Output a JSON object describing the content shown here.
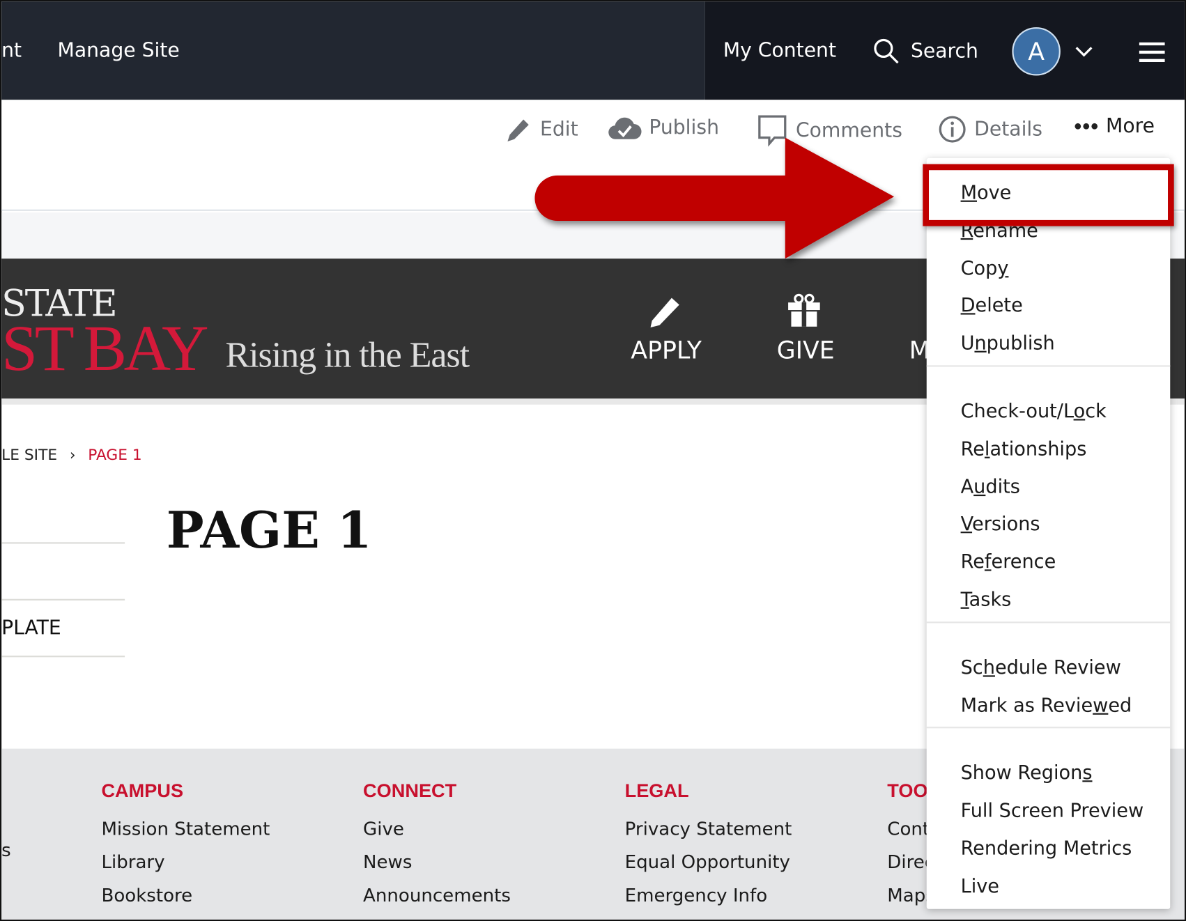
{
  "topnav": {
    "partial_left": "nt",
    "manage_site": "Manage Site",
    "my_content": "My Content",
    "search": "Search",
    "avatar_initial": "A"
  },
  "toolbar": {
    "edit": "Edit",
    "publish": "Publish",
    "comments": "Comments",
    "details": "Details",
    "more": "More"
  },
  "banner": {
    "logo_line1": "STATE",
    "logo_line2": "ST BAY",
    "tagline": "Rising in the East",
    "nav": [
      "APPLY",
      "GIVE",
      "M"
    ]
  },
  "breadcrumb": {
    "parent": "LE SITE",
    "separator": "›",
    "current": "PAGE 1"
  },
  "page": {
    "title": "PAGE 1",
    "sidebar_partial": "PLATE"
  },
  "footer": {
    "partial_left": "s",
    "columns": [
      {
        "heading": "CAMPUS",
        "links": [
          "Mission Statement",
          "Library",
          "Bookstore"
        ]
      },
      {
        "heading": "CONNECT",
        "links": [
          "Give",
          "News",
          "Announcements"
        ]
      },
      {
        "heading": "LEGAL",
        "links": [
          "Privacy Statement",
          "Equal Opportunity",
          "Emergency Info"
        ]
      },
      {
        "heading": "TOO",
        "links": [
          "Cont",
          "Direc",
          "Maps"
        ]
      }
    ]
  },
  "more_menu": {
    "groups": [
      [
        {
          "pre": "",
          "key": "M",
          "post": "ove"
        },
        {
          "pre": "",
          "key": "R",
          "post": "ename"
        },
        {
          "pre": "Cop",
          "key": "y",
          "post": ""
        },
        {
          "pre": "",
          "key": "D",
          "post": "elete"
        },
        {
          "pre": "U",
          "key": "n",
          "post": "publish"
        }
      ],
      [
        {
          "pre": "Check-out/L",
          "key": "o",
          "post": "ck"
        },
        {
          "pre": "Re",
          "key": "l",
          "post": "ationships"
        },
        {
          "pre": "A",
          "key": "u",
          "post": "dits"
        },
        {
          "pre": "",
          "key": "V",
          "post": "ersions"
        },
        {
          "pre": "Re",
          "key": "f",
          "post": "erence"
        },
        {
          "pre": "",
          "key": "T",
          "post": "asks"
        }
      ],
      [
        {
          "pre": "Sc",
          "key": "h",
          "post": "edule Review"
        },
        {
          "pre": "Mark as Revie",
          "key": "w",
          "post": "ed"
        }
      ],
      [
        {
          "pre": "Show Region",
          "key": "s",
          "post": ""
        },
        {
          "pre": "Full Screen Preview",
          "key": "",
          "post": ""
        },
        {
          "pre": "Rendering Metrics",
          "key": "",
          "post": ""
        },
        {
          "pre": "Live",
          "key": "",
          "post": ""
        }
      ]
    ],
    "highlighted": "Move"
  },
  "colors": {
    "topbar": "#222731",
    "topbar_right": "#14171f",
    "brand_red": "#c8102e",
    "annotation_red": "#c00000",
    "avatar": "#3b6ea5"
  }
}
